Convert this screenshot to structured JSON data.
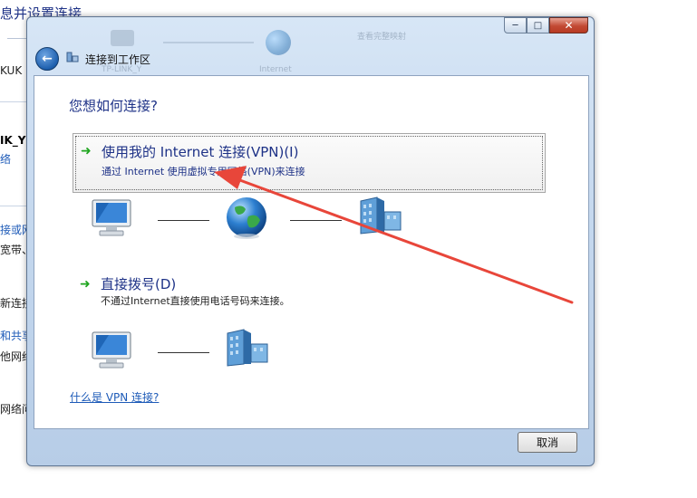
{
  "background": {
    "title": "息并设置连接",
    "items": [
      {
        "text": "KUK",
        "style": "plain"
      },
      {
        "text": "IK_Y",
        "style": "bold"
      },
      {
        "text": "络",
        "style": "link"
      },
      {
        "text": "接或网",
        "style": "link"
      },
      {
        "text": "宽带、",
        "style": "plain"
      },
      {
        "text": "新连接",
        "style": "plain"
      },
      {
        "text": "和共享",
        "style": "link"
      },
      {
        "text": "他网络",
        "style": "plain"
      },
      {
        "text": "网络问",
        "style": "plain"
      }
    ]
  },
  "dialog": {
    "title": "连接到工作区",
    "faded_labels": [
      "TP-LINK_Y",
      "Internet",
      "查看完整映射"
    ],
    "caption_buttons": {
      "minimize": "─",
      "maximize": "□",
      "close": "✕"
    },
    "heading": "您想如何连接?",
    "options": [
      {
        "title": "使用我的 Internet 连接(VPN)(I)",
        "description": "通过 Internet 使用虚拟专用网络(VPN)来连接",
        "selected": true
      },
      {
        "title": "直接拨号(D)",
        "description": "不通过Internet直接使用电话号码来连接。",
        "selected": false
      }
    ],
    "help_link": "什么是 VPN 连接?",
    "cancel_label": "取消"
  },
  "icons": {
    "back": "back-arrow-icon",
    "wizard": "network-wizard-icon",
    "option_arrow": "green-arrow-icon",
    "computer": "computer-icon",
    "globe": "globe-icon",
    "workplace": "workplace-building-icon"
  },
  "colors": {
    "heading": "#1e3287",
    "link": "#1e5bb8",
    "option_arrow": "#1ea51e",
    "annotation_arrow": "#e8463a"
  }
}
